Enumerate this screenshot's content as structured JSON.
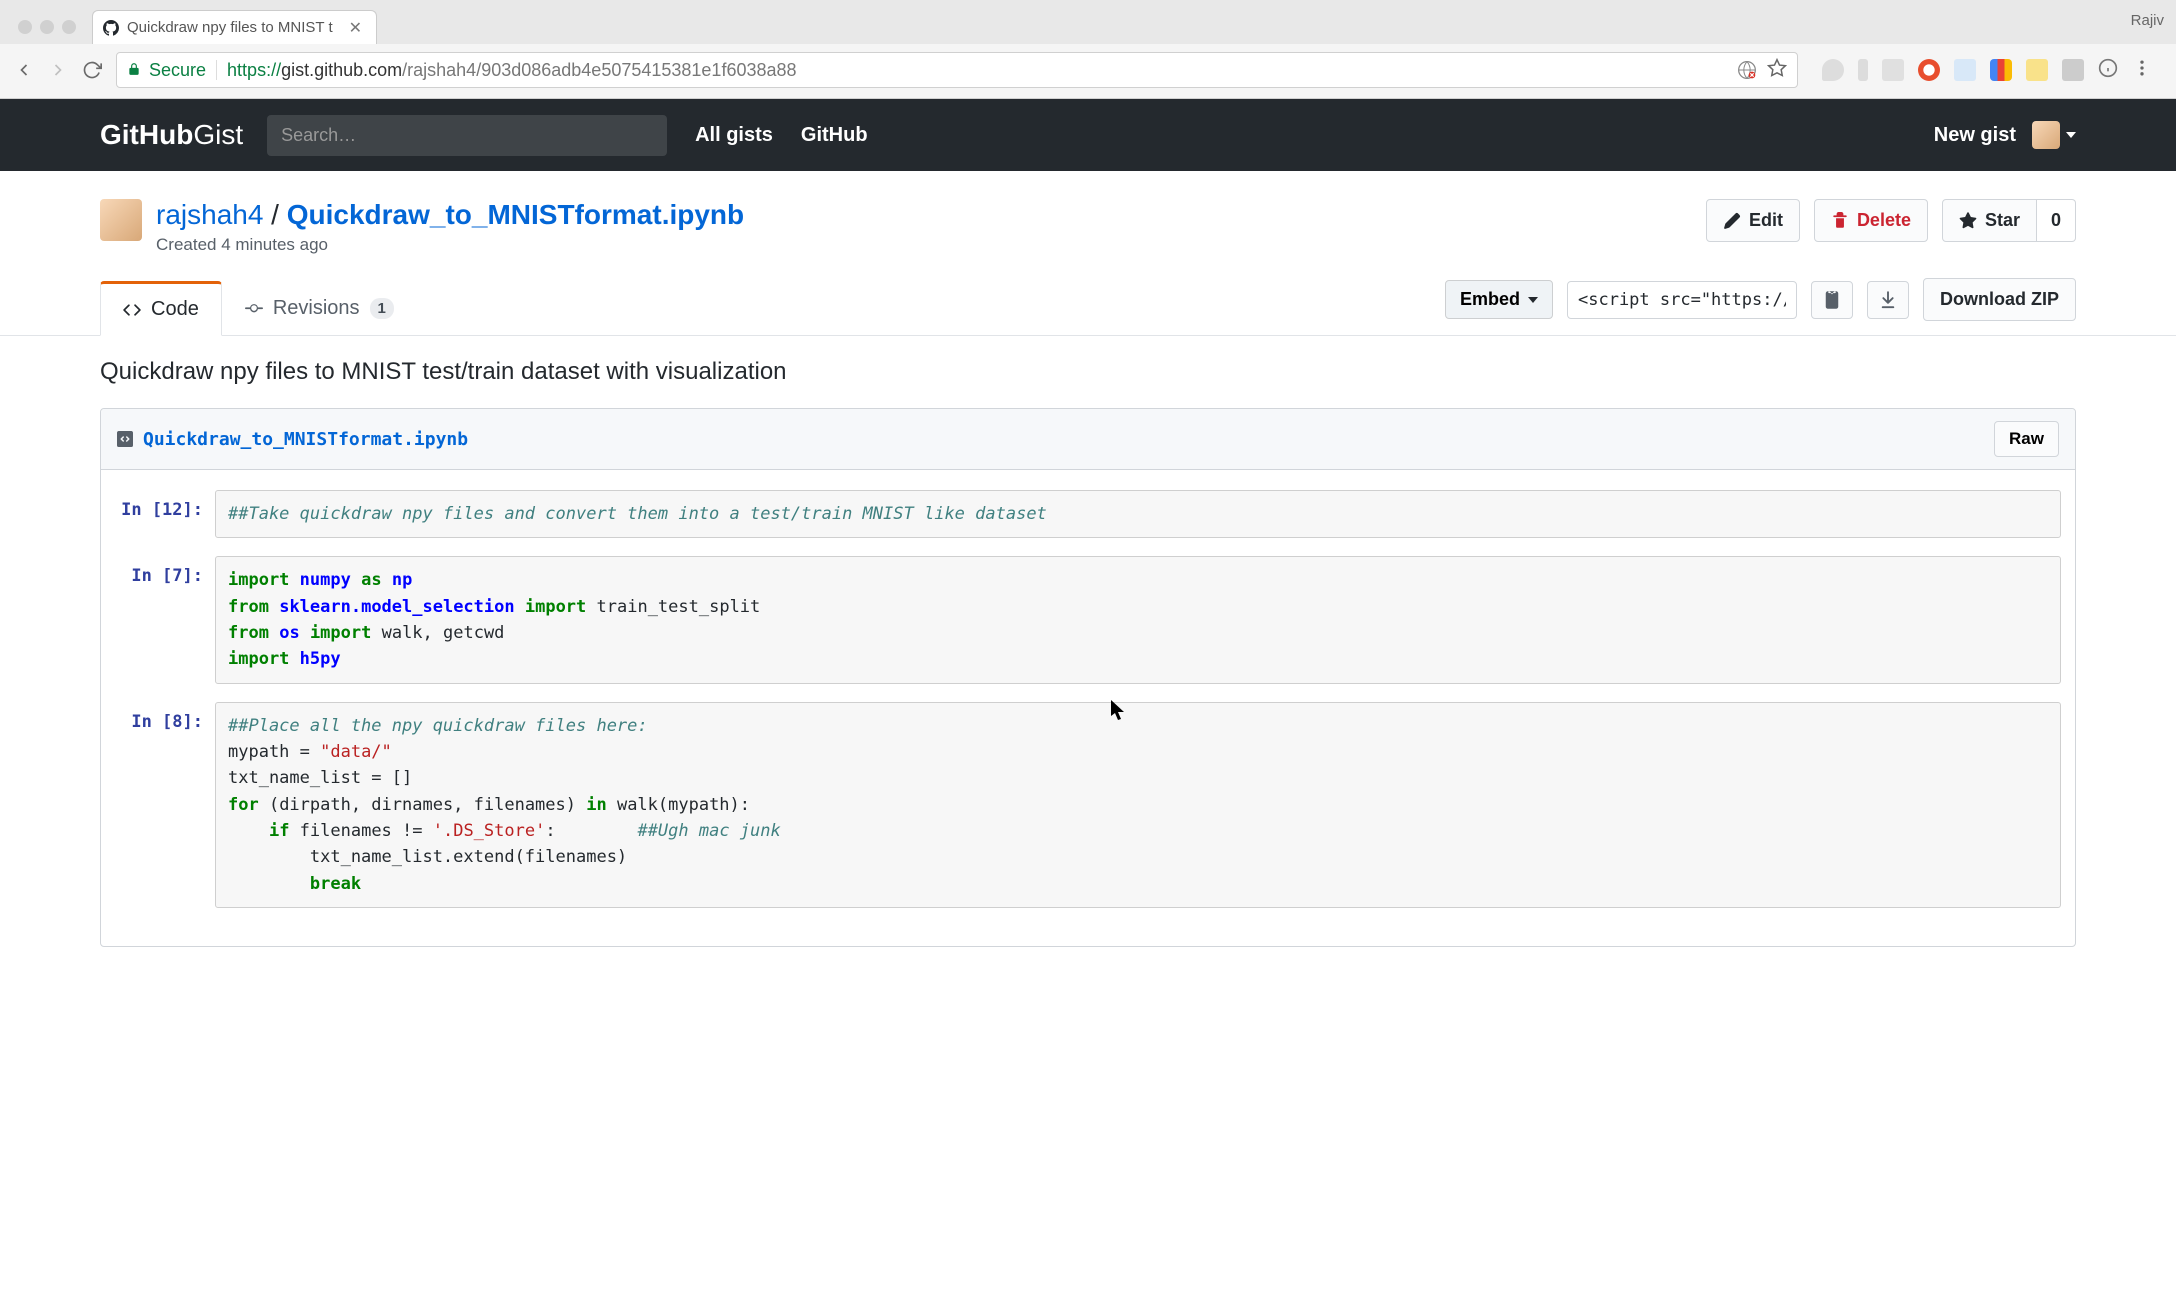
{
  "browser": {
    "profile_name": "Rajiv",
    "tab_title": "Quickdraw npy files to MNIST t",
    "secure_label": "Secure",
    "url_proto": "https://",
    "url_host": "gist.github.com",
    "url_path": "/rajshah4/903d086adb4e5075415381e1f6038a88"
  },
  "gh": {
    "logo_bold": "GitHub",
    "logo_light": "Gist",
    "search_placeholder": "Search…",
    "nav_allgists": "All gists",
    "nav_github": "GitHub",
    "new_gist": "New gist"
  },
  "gist": {
    "owner": "rajshah4",
    "sep": " / ",
    "filename": "Quickdraw_to_MNISTformat.ipynb",
    "created": "Created 4 minutes ago",
    "edit": "Edit",
    "delete": "Delete",
    "star": "Star",
    "star_count": "0"
  },
  "tabs": {
    "code": "Code",
    "revisions": "Revisions",
    "revisions_count": "1"
  },
  "embed": {
    "label": "Embed",
    "script_value": "<script src=\"https://gi",
    "download": "Download ZIP"
  },
  "description": "Quickdraw npy files to MNIST test/train dataset with visualization",
  "file": {
    "name": "Quickdraw_to_MNISTformat.ipynb",
    "raw": "Raw"
  },
  "cells": {
    "c1_prompt": "In [12]:",
    "c2_prompt": "In [7]:",
    "c3_prompt": "In [8]:"
  }
}
